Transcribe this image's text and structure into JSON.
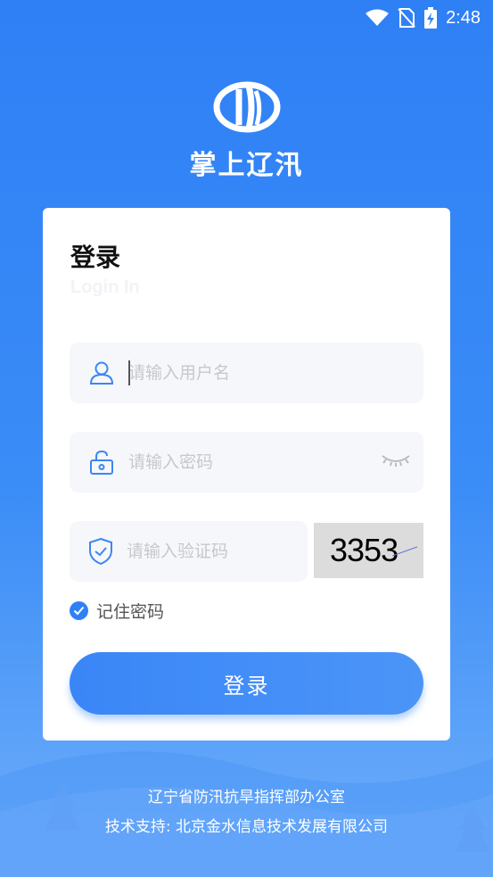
{
  "status": {
    "time": "2:48"
  },
  "app": {
    "title": "掌上辽汛"
  },
  "login": {
    "title": "登录",
    "subtitle": "Login In",
    "username_placeholder": "请输入用户名",
    "password_placeholder": "请输入密码",
    "captcha_placeholder": "请输入验证码",
    "captcha_code": "3353",
    "remember_label": "记住密码",
    "submit_label": "登录"
  },
  "footer": {
    "line1": "辽宁省防汛抗旱指挥部办公室",
    "line2": "技术支持: 北京金水信息技术发展有限公司"
  },
  "colors": {
    "primary": "#2f80f5",
    "field_bg": "#f6f7fa"
  }
}
